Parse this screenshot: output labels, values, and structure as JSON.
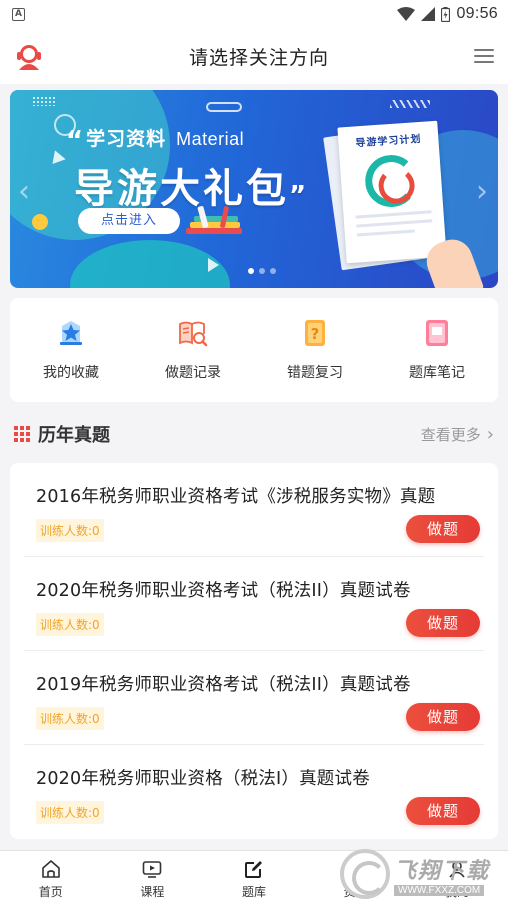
{
  "status_bar": {
    "time": "09:56",
    "notif_icon": "A"
  },
  "header": {
    "title": "请选择关注方向"
  },
  "banner": {
    "subtitle_cn": "学习资料",
    "subtitle_en": "Material",
    "headline": "导游大礼包",
    "enter_button": "点击进入",
    "paper_title": "导游学习计划",
    "open_quote": "“",
    "close_quote": "”"
  },
  "shortcuts": [
    {
      "label": "我的收藏",
      "icon": "star-badge-icon"
    },
    {
      "label": "做题记录",
      "icon": "book-search-icon"
    },
    {
      "label": "错题复习",
      "icon": "question-doc-icon"
    },
    {
      "label": "题库笔记",
      "icon": "note-icon"
    }
  ],
  "section": {
    "title": "历年真题",
    "more": "查看更多"
  },
  "exams": [
    {
      "title": "2016年税务师职业资格考试《涉税服务实物》真题",
      "count": "训练人数:0",
      "button": "做题"
    },
    {
      "title": "2020年税务师职业资格考试（税法II）真题试卷",
      "count": "训练人数:0",
      "button": "做题"
    },
    {
      "title": "2019年税务师职业资格考试（税法II）真题试卷",
      "count": "训练人数:0",
      "button": "做题"
    },
    {
      "title": "2020年税务师职业资格（税法I）真题试卷",
      "count": "训练人数:0",
      "button": "做题"
    }
  ],
  "bottom_nav": [
    {
      "label": "首页",
      "icon": "home-icon"
    },
    {
      "label": "课程",
      "icon": "video-icon"
    },
    {
      "label": "题库",
      "icon": "edit-icon"
    },
    {
      "label": "资料",
      "icon": "folder-icon"
    },
    {
      "label": "我的",
      "icon": "user-icon"
    }
  ],
  "watermark": {
    "text": "飞翔下载",
    "url": "WWW.FXXZ.COM"
  },
  "colors": {
    "accent_red": "#e53b36",
    "badge_bg": "#fff4dc",
    "badge_text": "#f0a52a",
    "banner_blue": "#2167d8"
  }
}
